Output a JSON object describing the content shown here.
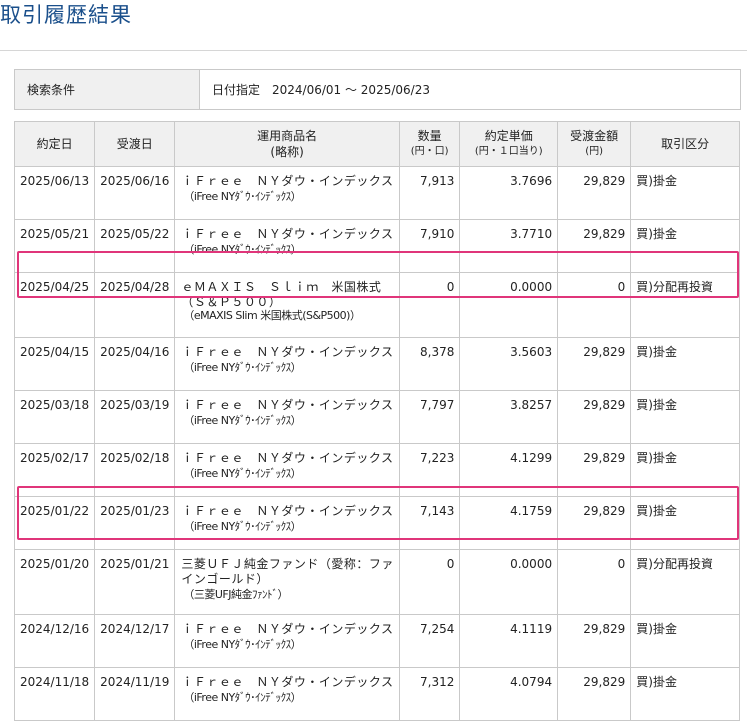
{
  "page": {
    "title": "取引履歴結果"
  },
  "search": {
    "label": "検索条件",
    "value": "日付指定　2024/06/01 〜 2025/06/23"
  },
  "table": {
    "headers": {
      "trade_date": "約定日",
      "settle_date": "受渡日",
      "product_line1": "運用商品名",
      "product_line2": "(略称)",
      "quantity_line1": "数量",
      "quantity_line2": "(円・口)",
      "price_line1": "約定単価",
      "price_line2": "(円・１口当り)",
      "amount_line1": "受渡金額",
      "amount_line2": "(円)",
      "type": "取引区分"
    },
    "rows": [
      {
        "trade_date": "2025/06/13",
        "settle_date": "2025/06/16",
        "name": "ｉＦｒｅｅ　ＮＹダウ・インデックス",
        "short": "（iFree NYﾀﾞｳ･ｲﾝﾃﾞｯｸｽ）",
        "quantity": "7,913",
        "price": "3.7696",
        "amount": "29,829",
        "type": "買)掛金"
      },
      {
        "trade_date": "2025/05/21",
        "settle_date": "2025/05/22",
        "name": "ｉＦｒｅｅ　ＮＹダウ・インデックス",
        "short": "（iFree NYﾀﾞｳ･ｲﾝﾃﾞｯｸｽ）",
        "quantity": "7,910",
        "price": "3.7710",
        "amount": "29,829",
        "type": "買)掛金"
      },
      {
        "trade_date": "2025/04/25",
        "settle_date": "2025/04/28",
        "name": "ｅＭＡＸＩＳ　Ｓｌｉｍ　米国株式",
        "name2": "（Ｓ＆Ｐ５００）",
        "short": "（eMAXIS Slim 米国株式(S&P500)）",
        "quantity": "0",
        "price": "0.0000",
        "amount": "0",
        "type": "買)分配再投資"
      },
      {
        "trade_date": "2025/04/15",
        "settle_date": "2025/04/16",
        "name": "ｉＦｒｅｅ　ＮＹダウ・インデックス",
        "short": "（iFree NYﾀﾞｳ･ｲﾝﾃﾞｯｸｽ）",
        "quantity": "8,378",
        "price": "3.5603",
        "amount": "29,829",
        "type": "買)掛金"
      },
      {
        "trade_date": "2025/03/18",
        "settle_date": "2025/03/19",
        "name": "ｉＦｒｅｅ　ＮＹダウ・インデックス",
        "short": "（iFree NYﾀﾞｳ･ｲﾝﾃﾞｯｸｽ）",
        "quantity": "7,797",
        "price": "3.8257",
        "amount": "29,829",
        "type": "買)掛金"
      },
      {
        "trade_date": "2025/02/17",
        "settle_date": "2025/02/18",
        "name": "ｉＦｒｅｅ　ＮＹダウ・インデックス",
        "short": "（iFree NYﾀﾞｳ･ｲﾝﾃﾞｯｸｽ）",
        "quantity": "7,223",
        "price": "4.1299",
        "amount": "29,829",
        "type": "買)掛金"
      },
      {
        "trade_date": "2025/01/22",
        "settle_date": "2025/01/23",
        "name": "ｉＦｒｅｅ　ＮＹダウ・インデックス",
        "short": "（iFree NYﾀﾞｳ･ｲﾝﾃﾞｯｸｽ）",
        "quantity": "7,143",
        "price": "4.1759",
        "amount": "29,829",
        "type": "買)掛金"
      },
      {
        "trade_date": "2025/01/20",
        "settle_date": "2025/01/21",
        "name": "三菱ＵＦＪ純金ファンド（愛称：ファ",
        "name2": "インゴールド）",
        "short": "（三菱UFJ純金ﾌｧﾝﾄﾞ）",
        "quantity": "0",
        "price": "0.0000",
        "amount": "0",
        "type": "買)分配再投資"
      },
      {
        "trade_date": "2024/12/16",
        "settle_date": "2024/12/17",
        "name": "ｉＦｒｅｅ　ＮＹダウ・インデックス",
        "short": "（iFree NYﾀﾞｳ･ｲﾝﾃﾞｯｸｽ）",
        "quantity": "7,254",
        "price": "4.1119",
        "amount": "29,829",
        "type": "買)掛金"
      },
      {
        "trade_date": "2024/11/18",
        "settle_date": "2024/11/19",
        "name": "ｉＦｒｅｅ　ＮＹダウ・インデックス",
        "short": "（iFree NYﾀﾞｳ･ｲﾝﾃﾞｯｸｽ）",
        "quantity": "7,312",
        "price": "4.0794",
        "amount": "29,829",
        "type": "買)掛金"
      }
    ]
  },
  "colors": {
    "title": "#1a4f8b",
    "highlight": "#e0357a",
    "header_bg": "#f0f0f0",
    "border": "#c9c9c9"
  }
}
